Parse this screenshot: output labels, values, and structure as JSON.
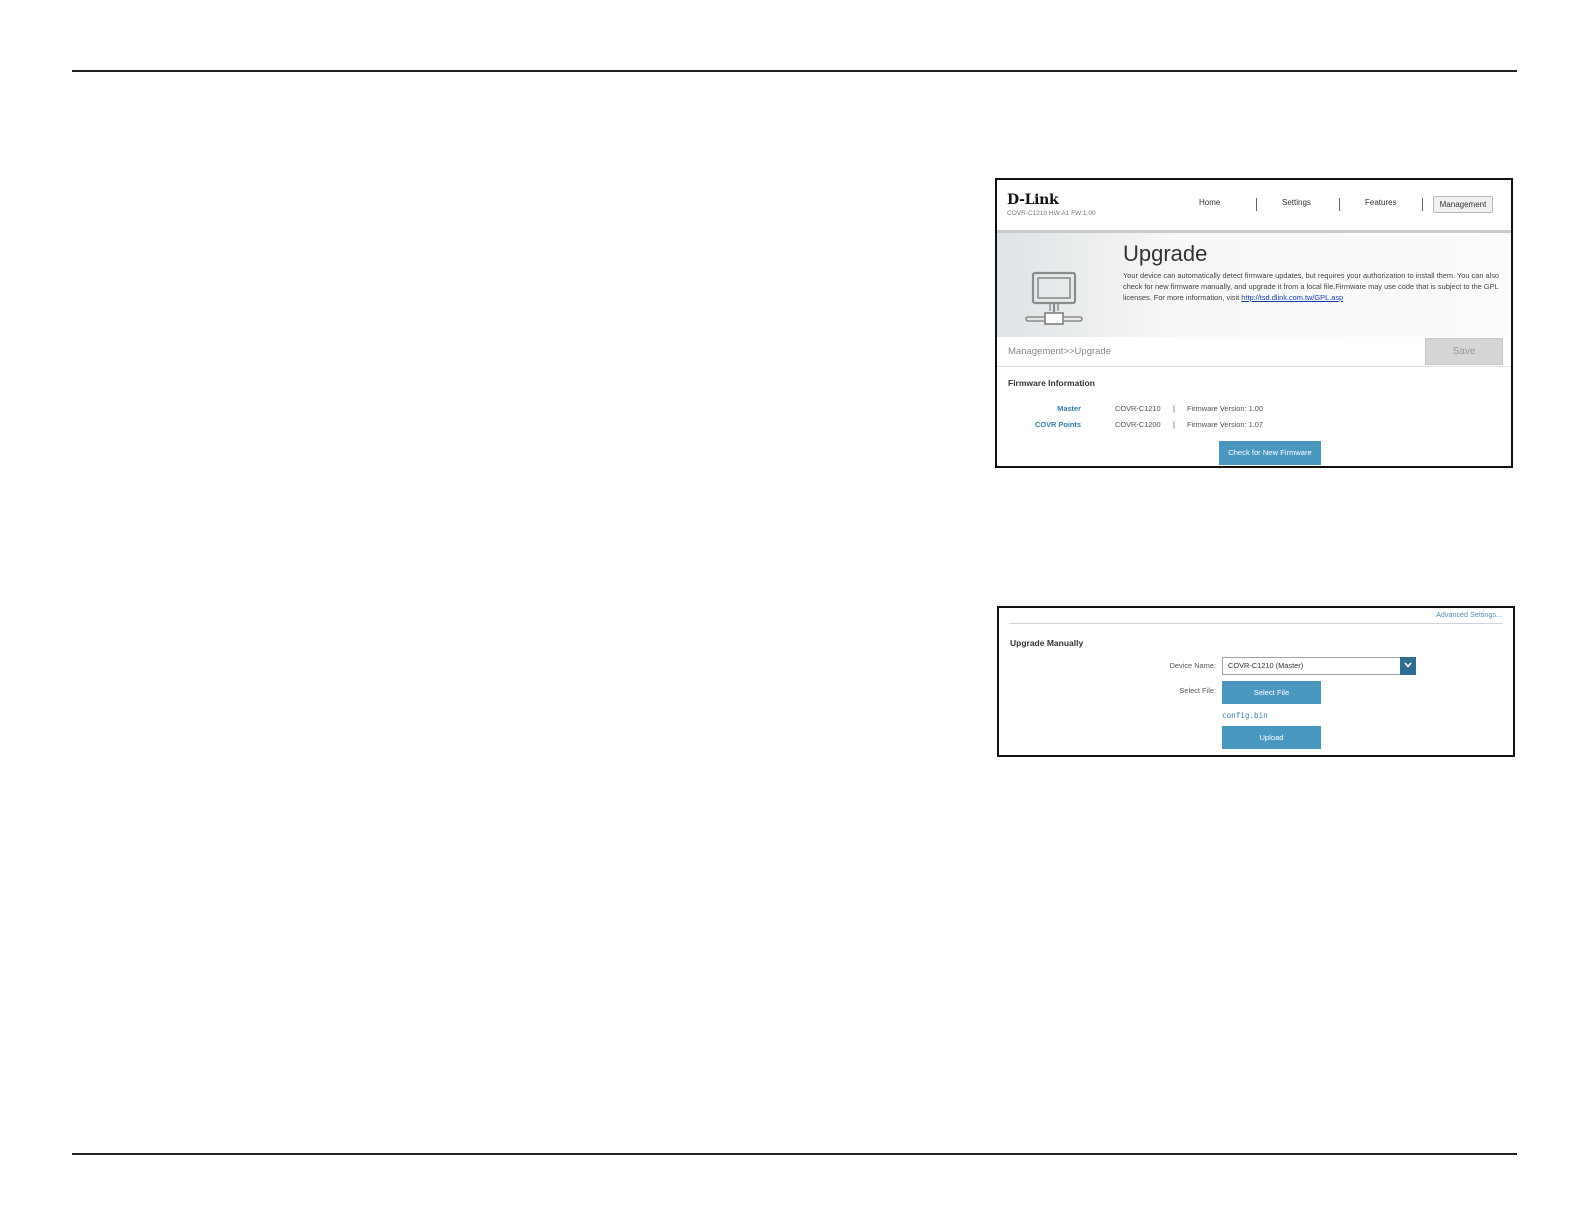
{
  "screen1": {
    "brand": "D-Link",
    "model_line": "COVR-C1210 HW:A1 FW:1.00",
    "nav": [
      "Home",
      "Settings",
      "Features",
      "Management"
    ],
    "active_nav": "Management",
    "page_title": "Upgrade",
    "description": "Your device can automatically detect firmware updates, but requires your authorization to install them. You can also check for new firmware manually, and upgrade it from a local file.Firmware may use code that is subject to the GPL licenses. For more information, visit ",
    "gpl_link": "http://tsd.dlink.com.tw/GPL.asp",
    "breadcrumb": "Management>>Upgrade",
    "save_label": "Save",
    "firmware_section_title": "Firmware Information",
    "firmware": [
      {
        "label": "Master",
        "model": "COVR-C1210",
        "separator": "|",
        "version": "Firmware Version: 1.00"
      },
      {
        "label": "COVR Points",
        "model": "COVR-C1200",
        "separator": "|",
        "version": "Firmware Version: 1.07"
      }
    ],
    "check_button": "Check for New Firmware"
  },
  "screen2": {
    "advanced_link": "Advanced Settings...",
    "section_title": "Upgrade Manually",
    "device_name_label": "Device Name:",
    "device_name_value": "COVR-C1210 (Master)",
    "select_file_label": "Select File:",
    "select_file_button": "Select File",
    "file_name": "config.bin",
    "upload_button": "Upload"
  },
  "colors": {
    "accent_blue": "#4a97bf",
    "label_blue": "#3a7fa6",
    "dropdown_arrow_bg": "#2e6f8f",
    "save_disabled": "#d6d6d6"
  },
  "icons": {
    "banner_icon": "monitor-network-icon",
    "dropdown_icon": "chevron-down-icon"
  }
}
